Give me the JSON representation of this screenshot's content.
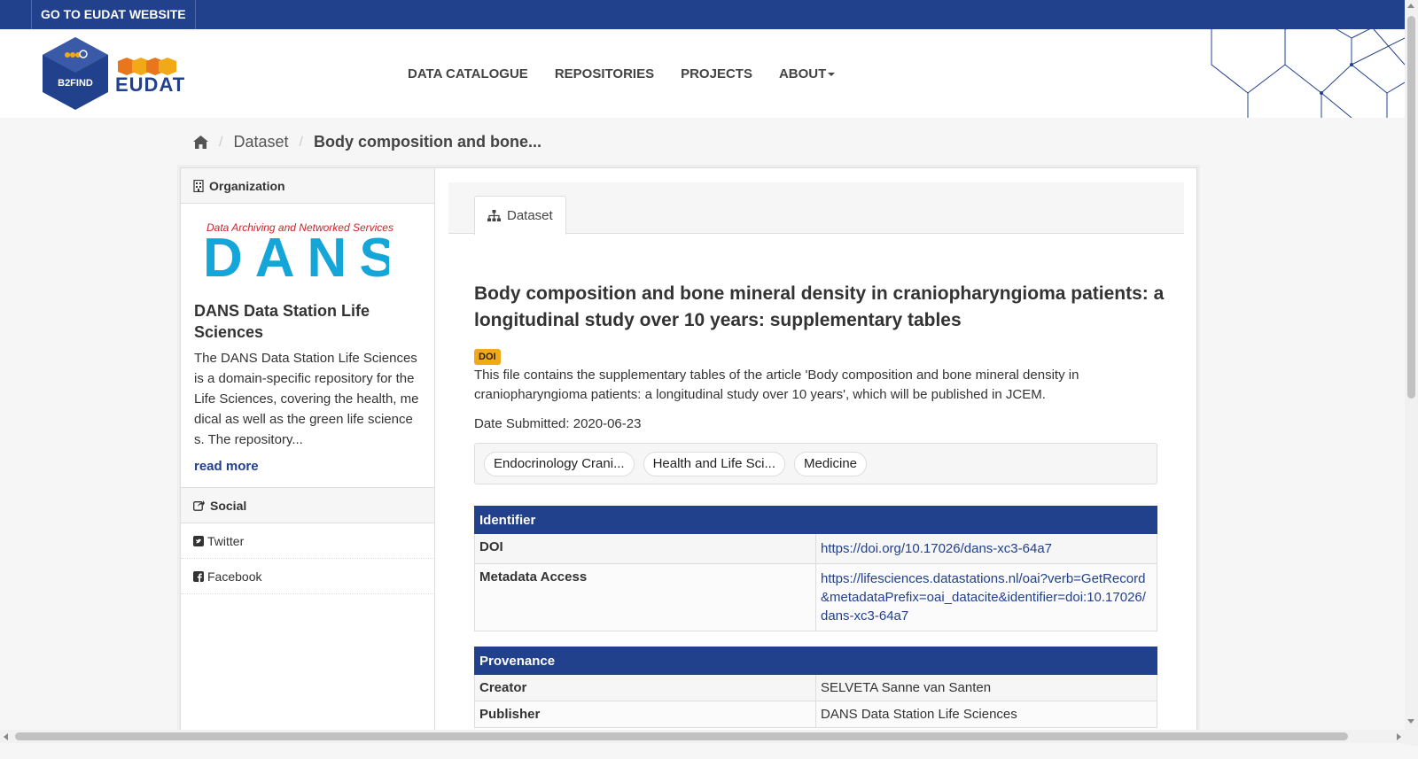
{
  "topbar": {
    "link_label": "GO TO EUDAT WEBSITE"
  },
  "masthead": {
    "logo_label": "B2FIND",
    "brand": "EUDAT",
    "nav": [
      {
        "label": "DATA CATALOGUE"
      },
      {
        "label": "REPOSITORIES"
      },
      {
        "label": "PROJECTS"
      },
      {
        "label": "ABOUT"
      }
    ]
  },
  "breadcrumb": {
    "level1": "Dataset",
    "level2": "Body composition and bone..."
  },
  "organization": {
    "heading": "Organization",
    "logo_tagline": "Data Archiving and Networked Services",
    "logo_text": "DANS",
    "title": "DANS Data Station Life Sciences",
    "description": "The DANS Data Station Life Sciences is a domain-specific repository for the Life Sciences, covering the health, medical as well as the green life sciences. The repository...",
    "read_more": "read more"
  },
  "social": {
    "heading": "Social",
    "items": [
      {
        "label": "Twitter"
      },
      {
        "label": "Facebook"
      }
    ]
  },
  "tabs": [
    {
      "label": "Dataset"
    }
  ],
  "dataset": {
    "title": "Body composition and bone mineral density in craniopharyngioma patients: a longitudinal study over 10 years: supplementary tables",
    "badge": "DOI",
    "notes": "This file contains the supplementary tables of the article 'Body composition and bone mineral density in craniopharyngioma patients: a longitudinal study over 10 years', which will be published in JCEM.",
    "date_submitted": "Date Submitted: 2020-06-23",
    "tags": [
      {
        "label": "Endocrinology Crani..."
      },
      {
        "label": "Health and Life Sci..."
      },
      {
        "label": "Medicine"
      }
    ]
  },
  "identifier": {
    "heading": "Identifier",
    "rows": [
      {
        "key": "DOI",
        "value": "https://doi.org/10.17026/dans-xc3-64a7"
      },
      {
        "key": "Metadata Access",
        "value": "https://lifesciences.datastations.nl/oai?verb=GetRecord&metadataPrefix=oai_datacite&identifier=doi:10.17026/dans-xc3-64a7"
      }
    ]
  },
  "provenance": {
    "heading": "Provenance",
    "rows": [
      {
        "key": "Creator",
        "value": "SELVETA Sanne van Santen"
      },
      {
        "key": "Publisher",
        "value": "DANS Data Station Life Sciences"
      }
    ]
  },
  "colors": {
    "brand": "#22418c",
    "doi_badge": "#f2a918",
    "dans_red": "#c8262d",
    "dans_cyan": "#14a6d8"
  }
}
